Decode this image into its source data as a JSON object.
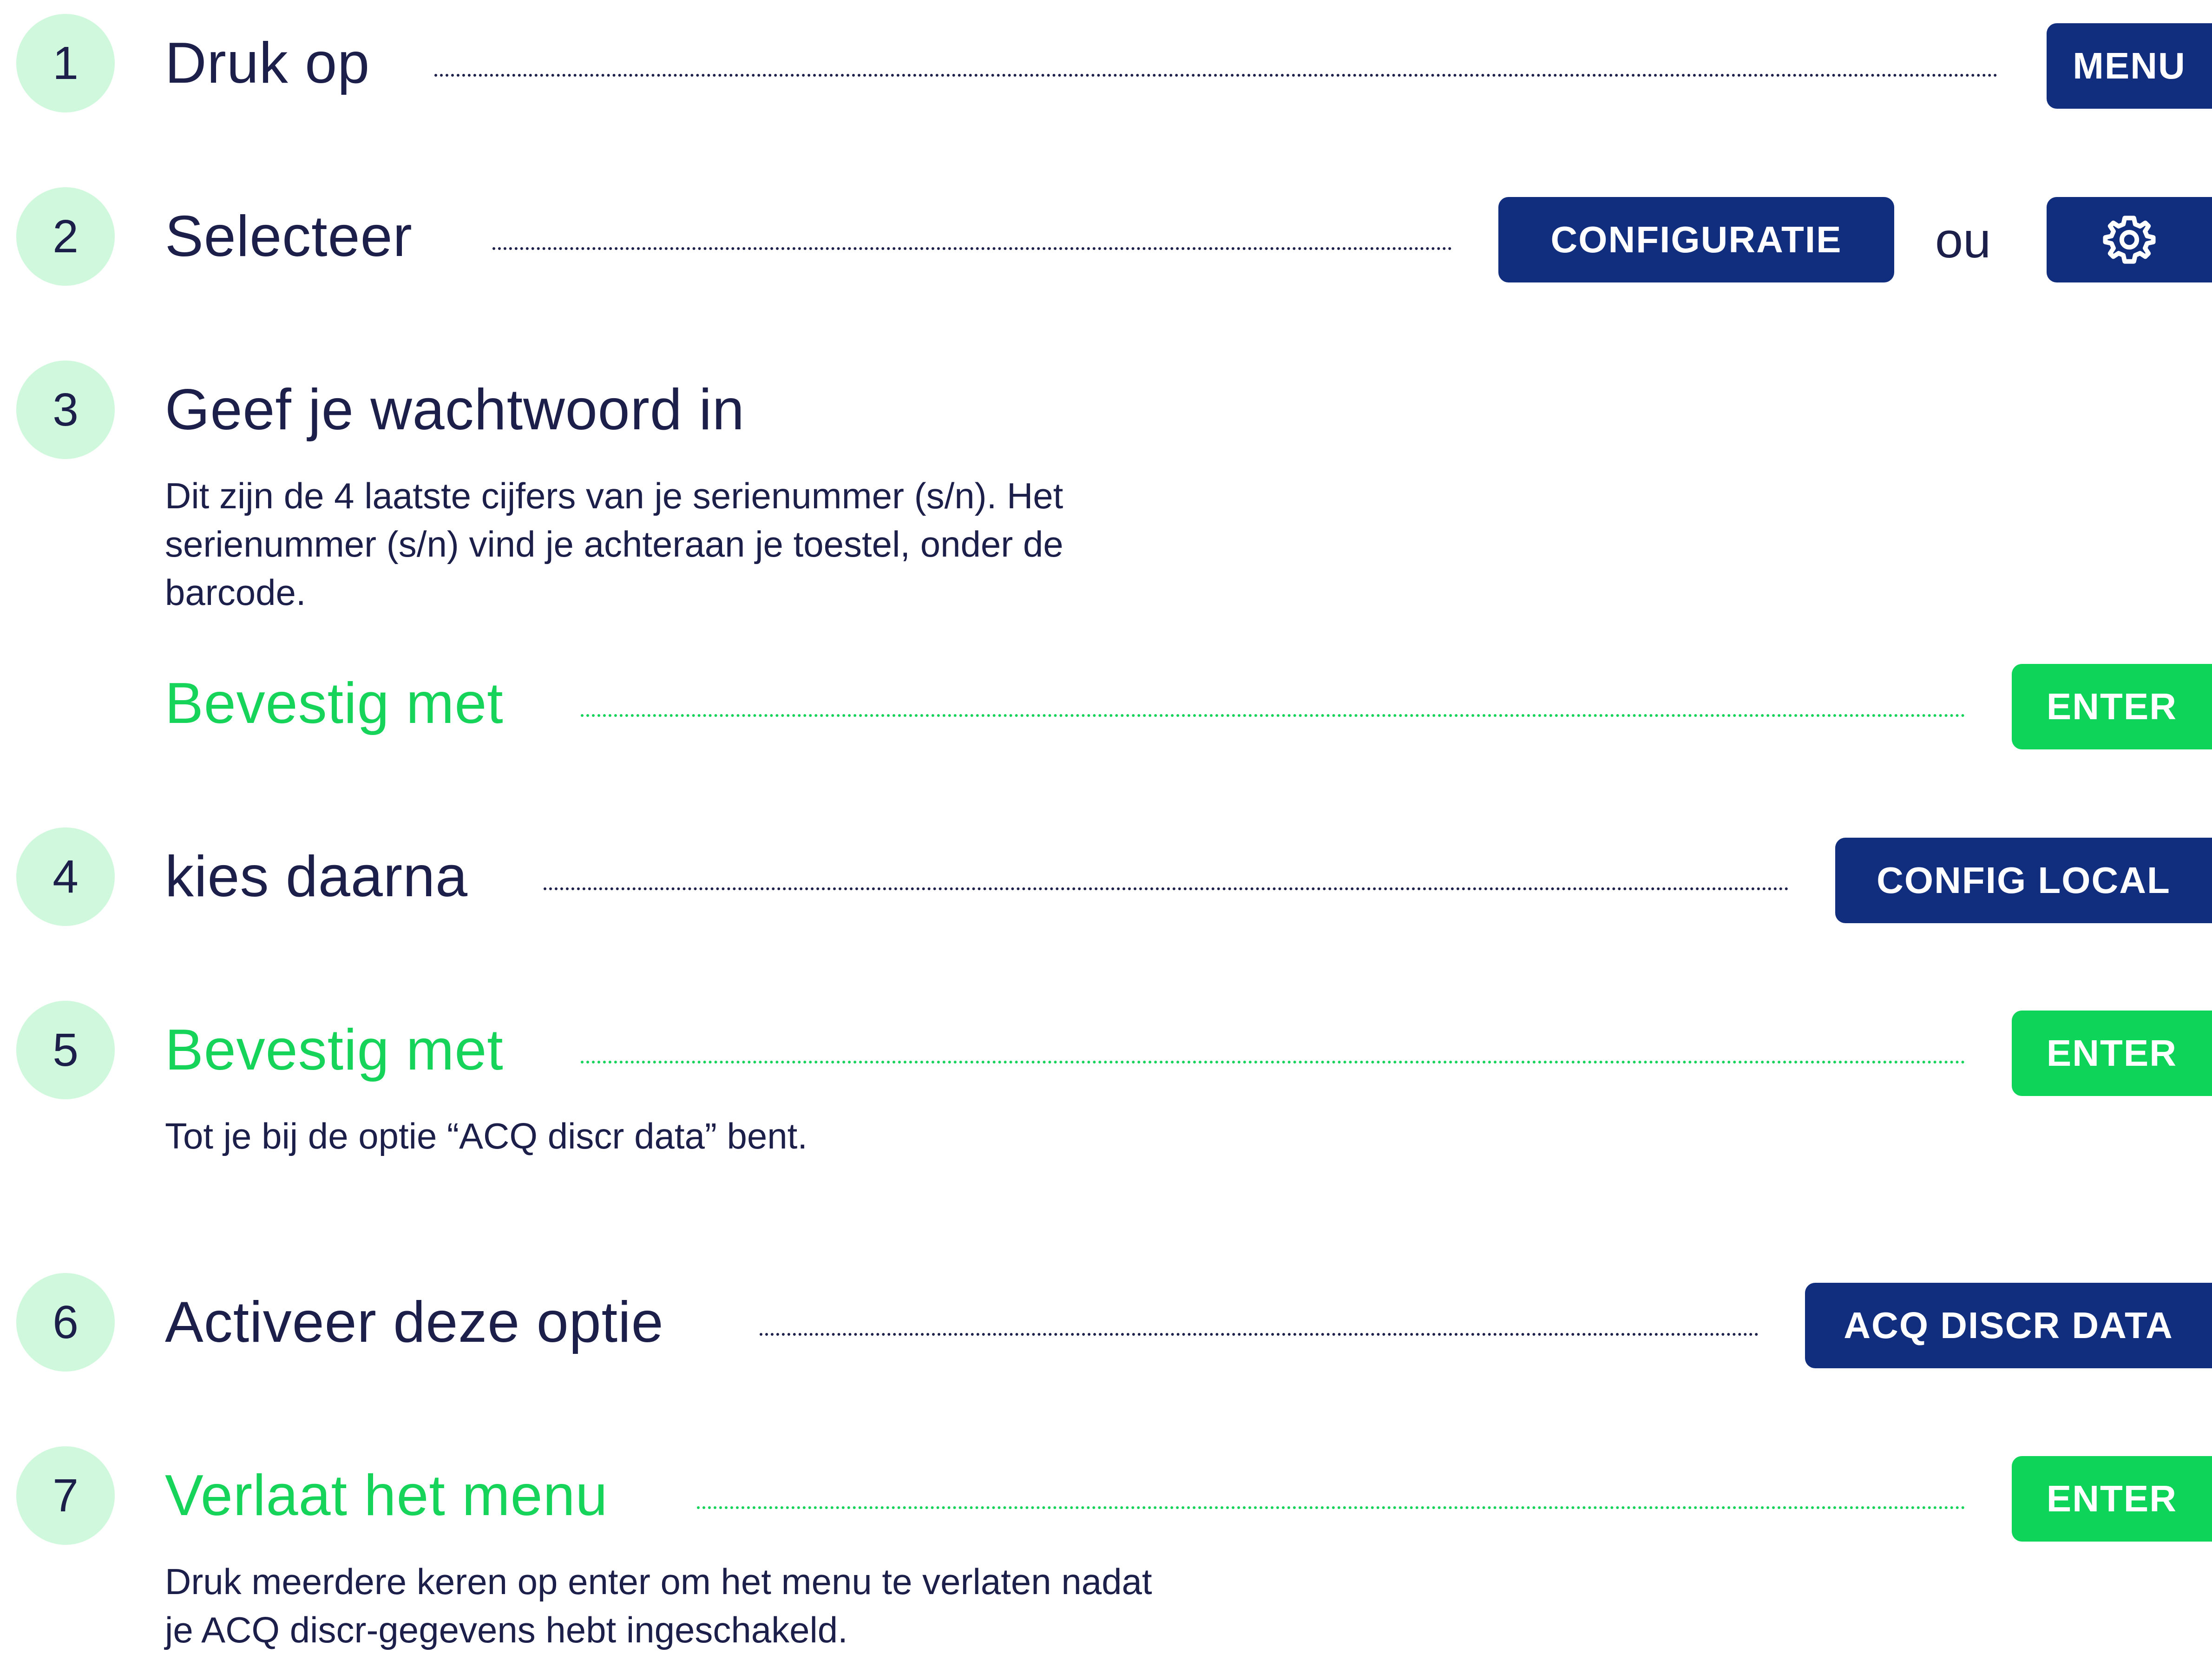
{
  "steps": [
    {
      "number": "1",
      "title": "Druk op",
      "button": "MENU"
    },
    {
      "number": "2",
      "title": "Selecteer",
      "button": "CONFIGURATIE",
      "or_text": "ou",
      "icon": "gear-icon"
    },
    {
      "number": "3",
      "title": "Geef je wachtwoord in",
      "description_lines": [
        "Dit zijn de 4 laatste cijfers van je serienummer (s/n). Het",
        "serienummer (s/n) vind je achteraan je toestel, onder de",
        "barcode."
      ],
      "confirm_label": "Bevestig met",
      "confirm_button": "ENTER"
    },
    {
      "number": "4",
      "title": "kies daarna",
      "button": "CONFIG LOCAL"
    },
    {
      "number": "5",
      "title": "Bevestig met",
      "button": "ENTER",
      "description": "Tot je bij de optie “ACQ discr data” bent."
    },
    {
      "number": "6",
      "title": "Activeer deze optie",
      "button": "ACQ DISCR DATA"
    },
    {
      "number": "7",
      "title": "Verlaat het menu",
      "button": "ENTER",
      "description_lines": [
        "Druk meerdere keren op enter om het menu te verlaten nadat",
        "je ACQ discr-gegevens hebt ingeschakeld."
      ]
    }
  ],
  "colors": {
    "navy": "#112d7e",
    "green": "#0fd45a",
    "circle_bg": "#cff8dc",
    "text_dark": "#1c1f4a"
  }
}
